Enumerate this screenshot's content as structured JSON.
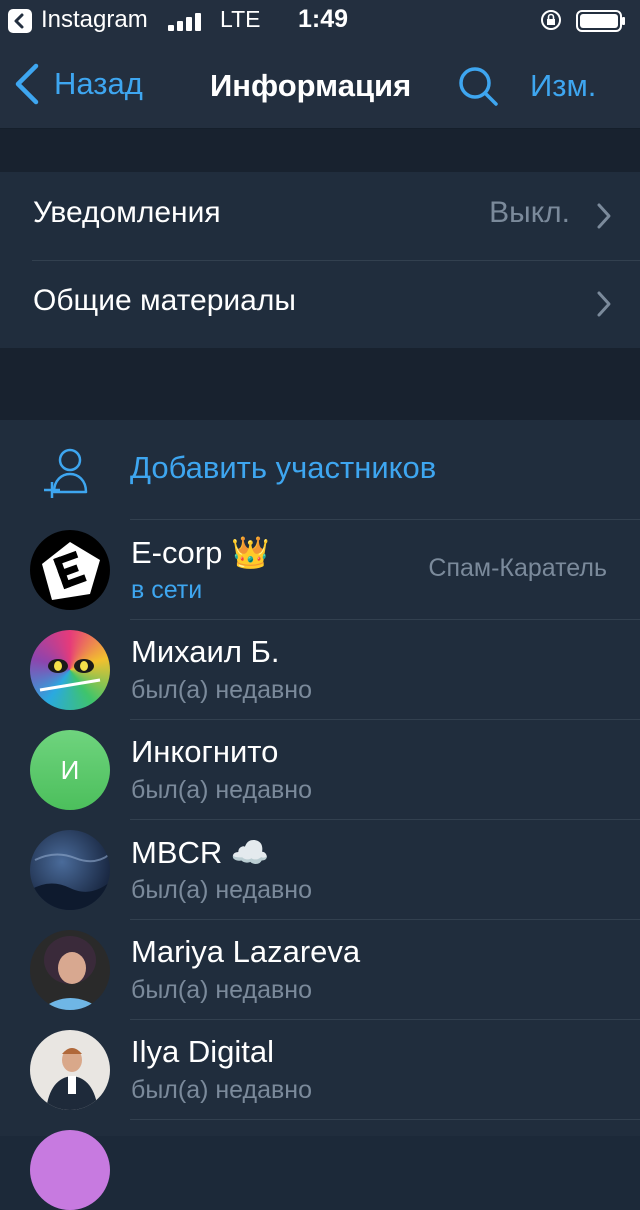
{
  "status_bar": {
    "app": "Instagram",
    "network": "LTE",
    "time": "1:49"
  },
  "nav": {
    "back_label": "Назад",
    "title": "Информация",
    "edit_label": "Изм."
  },
  "settings": {
    "notifications": {
      "label": "Уведомления",
      "value": "Выкл."
    },
    "shared_media": {
      "label": "Общие материалы"
    }
  },
  "members": {
    "add_label": "Добавить участников",
    "list": [
      {
        "name": "E-corp",
        "emoji": "👑",
        "status": "в сети",
        "role": "Спам-Каратель"
      },
      {
        "name": "Михаил Б.",
        "status": "был(а) недавно"
      },
      {
        "name": "Инкогнито",
        "initial": "И",
        "status": "был(а) недавно"
      },
      {
        "name": "MBCR",
        "emoji": "☁️",
        "status": "был(а) недавно"
      },
      {
        "name": "Mariya Lazareva",
        "status": "был(а) недавно"
      },
      {
        "name": "Ilya Digital",
        "status": "был(а) недавно"
      }
    ]
  },
  "colors": {
    "accent": "#3ea6f0",
    "background": "#1c2939",
    "secondary_text": "#7b8a9b",
    "avatar_green": "#5cc66b"
  }
}
